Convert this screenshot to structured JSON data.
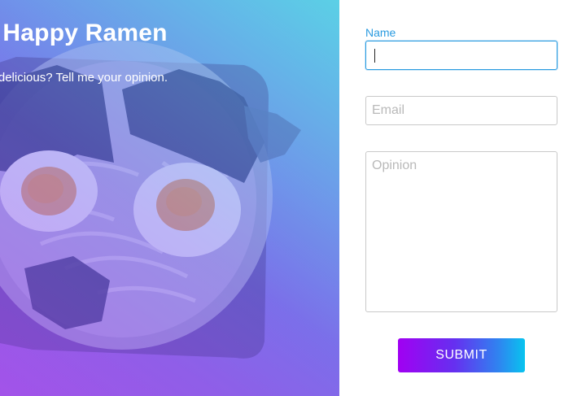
{
  "hero": {
    "title": "s Happy Ramen",
    "subtitle": "okes delicious? Tell me your opinion."
  },
  "form": {
    "name_label": "Name",
    "name_value": "",
    "email_placeholder": "Email",
    "opinion_placeholder": "Opinion",
    "submit_label": "SUBMIT"
  },
  "colors": {
    "accent": "#2a9be0",
    "button_gradient_start": "#a100f2",
    "button_gradient_end": "#08c4ef"
  }
}
